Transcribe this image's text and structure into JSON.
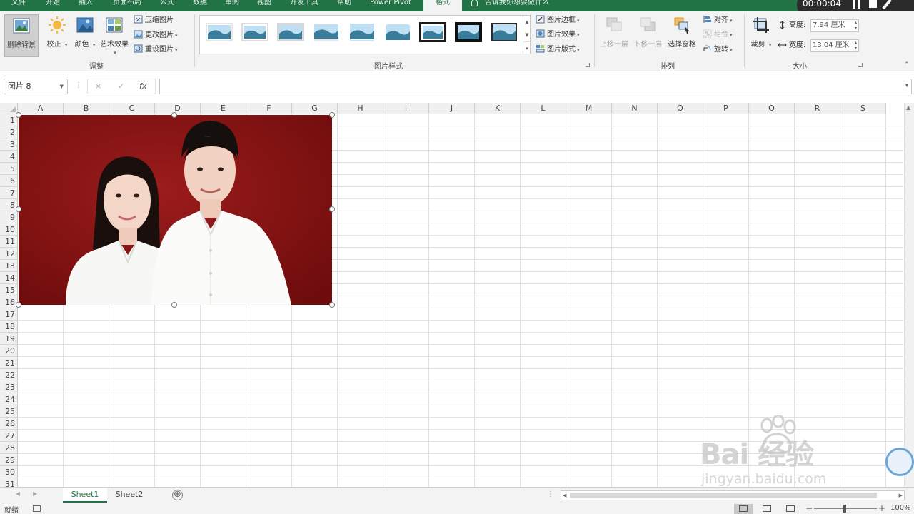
{
  "ribbon": {
    "tabs": [
      "文件",
      "开始",
      "插入",
      "页面布局",
      "公式",
      "数据",
      "审阅",
      "视图",
      "开发工具",
      "帮助",
      "Power Pivot",
      "格式"
    ],
    "active_tab": "格式",
    "tell_me": "告诉我你想要做什么",
    "adjust_group": {
      "label": "调整",
      "remove_background": "删除背景",
      "corrections": "校正",
      "color": "颜色",
      "artistic_effects": "艺术效果",
      "compress": "压缩图片",
      "change_picture": "更改图片",
      "reset_picture": "重设图片"
    },
    "styles_group": {
      "label": "图片样式",
      "border": "图片边框",
      "effects": "图片效果",
      "layout": "图片版式"
    },
    "arrange_group": {
      "label": "排列",
      "bring_forward": "上移一层",
      "send_backward": "下移一层",
      "selection_pane": "选择窗格",
      "align": "对齐",
      "group": "组合",
      "rotate": "旋转"
    },
    "size_group": {
      "label": "大小",
      "crop": "裁剪",
      "height_label": "高度:",
      "height_value": "7.94 厘米",
      "width_label": "宽度:",
      "width_value": "13.04 厘米"
    }
  },
  "recorder": {
    "time": "00:00:04"
  },
  "formula_bar": {
    "name_box": "图片 8",
    "cancel": "×",
    "enter": "✓",
    "fx": "fx",
    "formula": ""
  },
  "grid": {
    "columns": [
      "A",
      "B",
      "C",
      "D",
      "E",
      "F",
      "G",
      "H",
      "I",
      "J",
      "K",
      "L",
      "M",
      "N",
      "O",
      "P",
      "Q",
      "R",
      "S"
    ],
    "rows": [
      "1",
      "2",
      "3",
      "4",
      "5",
      "6",
      "7",
      "8",
      "9",
      "10",
      "11",
      "12",
      "13",
      "14",
      "15",
      "16",
      "17",
      "18",
      "19",
      "20",
      "21",
      "22",
      "23",
      "24",
      "25",
      "26",
      "27",
      "28",
      "29",
      "30",
      "31"
    ]
  },
  "picture": {
    "name": "图片 8",
    "background_color": "#8c1414"
  },
  "sheets": {
    "tabs": [
      "Sheet1",
      "Sheet2"
    ],
    "active": "Sheet1",
    "add": "⊕"
  },
  "status": {
    "ready": "就绪",
    "zoom": "100%"
  },
  "watermark": {
    "logo": "Bai 经验",
    "url": "jingyan.baidu.com"
  },
  "colors": {
    "accent": "#217346",
    "ribbon": "#f3f3f3"
  }
}
